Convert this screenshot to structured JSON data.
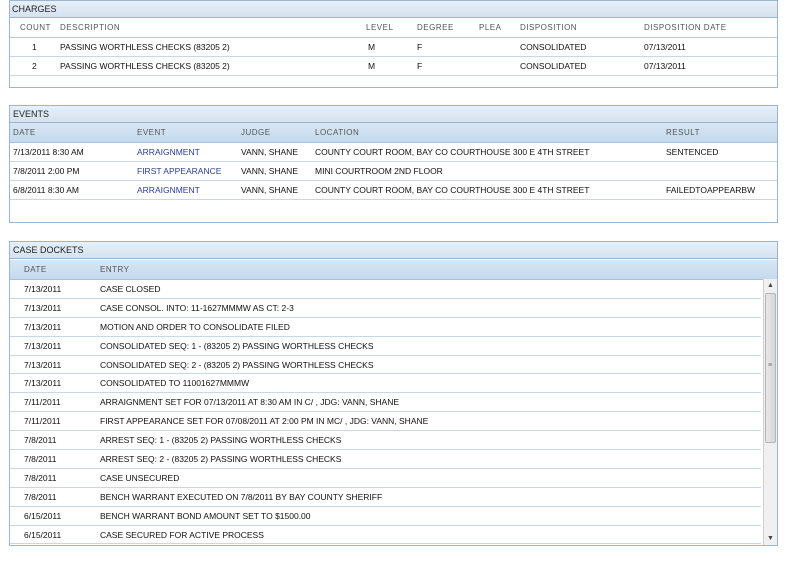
{
  "charges": {
    "title": "CHARGES",
    "columns": {
      "count": "COUNT",
      "description": "DESCRIPTION",
      "level": "LEVEL",
      "degree": "DEGREE",
      "plea": "PLEA",
      "disposition": "DISPOSITION",
      "disposition_date": "DISPOSITION DATE"
    },
    "rows": [
      {
        "count": "1",
        "description": "PASSING WORTHLESS CHECKS (83205 2)",
        "level": "M",
        "degree": "F",
        "plea": "",
        "disposition": "CONSOLIDATED",
        "disposition_date": "07/13/2011"
      },
      {
        "count": "2",
        "description": "PASSING WORTHLESS CHECKS (83205 2)",
        "level": "M",
        "degree": "F",
        "plea": "",
        "disposition": "CONSOLIDATED",
        "disposition_date": "07/13/2011"
      }
    ]
  },
  "events": {
    "title": "EVENTS",
    "columns": {
      "date": "DATE",
      "event": "EVENT",
      "judge": "JUDGE",
      "location": "LOCATION",
      "result": "RESULT"
    },
    "rows": [
      {
        "date": "7/13/2011 8:30 AM",
        "event": "ARRAIGNMENT",
        "judge": "VANN, SHANE",
        "location": "COUNTY COURT ROOM, BAY CO COURTHOUSE 300 E 4TH STREET",
        "result": "SENTENCED"
      },
      {
        "date": "7/8/2011 2:00 PM",
        "event": "FIRST APPEARANCE",
        "judge": "VANN, SHANE",
        "location": "MINI COURTROOM 2ND FLOOR",
        "result": ""
      },
      {
        "date": "6/8/2011 8:30 AM",
        "event": "ARRAIGNMENT",
        "judge": "VANN, SHANE",
        "location": "COUNTY COURT ROOM, BAY CO COURTHOUSE 300 E 4TH STREET",
        "result": "FAILEDTOAPPEARBW"
      }
    ]
  },
  "dockets": {
    "title": "CASE DOCKETS",
    "columns": {
      "date": "DATE",
      "entry": "ENTRY"
    },
    "rows": [
      {
        "date": "7/13/2011",
        "entry": "CASE CLOSED"
      },
      {
        "date": "7/13/2011",
        "entry": "CASE CONSOL. INTO: 11-1627MMMW AS CT: 2-3"
      },
      {
        "date": "7/13/2011",
        "entry": "MOTION AND ORDER TO CONSOLIDATE FILED"
      },
      {
        "date": "7/13/2011",
        "entry": "CONSOLIDATED SEQ: 1 - (83205 2) PASSING WORTHLESS CHECKS"
      },
      {
        "date": "7/13/2011",
        "entry": "CONSOLIDATED SEQ: 2 - (83205 2) PASSING WORTHLESS CHECKS"
      },
      {
        "date": "7/13/2011",
        "entry": "CONSOLIDATED TO 11001627MMMW"
      },
      {
        "date": "7/11/2011",
        "entry": "ARRAIGNMENT SET FOR 07/13/2011 AT 8:30 AM IN C/ , JDG: VANN, SHANE"
      },
      {
        "date": "7/11/2011",
        "entry": "FIRST APPEARANCE SET FOR 07/08/2011 AT 2:00 PM IN MC/ , JDG: VANN, SHANE"
      },
      {
        "date": "7/8/2011",
        "entry": "ARREST SEQ: 1 - (83205 2) PASSING WORTHLESS CHECKS"
      },
      {
        "date": "7/8/2011",
        "entry": "ARREST SEQ: 2 - (83205 2) PASSING WORTHLESS CHECKS"
      },
      {
        "date": "7/8/2011",
        "entry": "CASE UNSECURED"
      },
      {
        "date": "7/8/2011",
        "entry": "BENCH WARRANT EXECUTED ON 7/8/2011 BY BAY COUNTY SHERIFF"
      },
      {
        "date": "6/15/2011",
        "entry": "BENCH WARRANT BOND AMOUNT SET TO $1500.00"
      },
      {
        "date": "6/15/2011",
        "entry": "CASE SECURED FOR ACTIVE PROCESS"
      }
    ],
    "scrollbar": {
      "up_icon": "triangle-up",
      "down_icon": "triangle-down",
      "grip_icon": "grip-lines"
    }
  }
}
